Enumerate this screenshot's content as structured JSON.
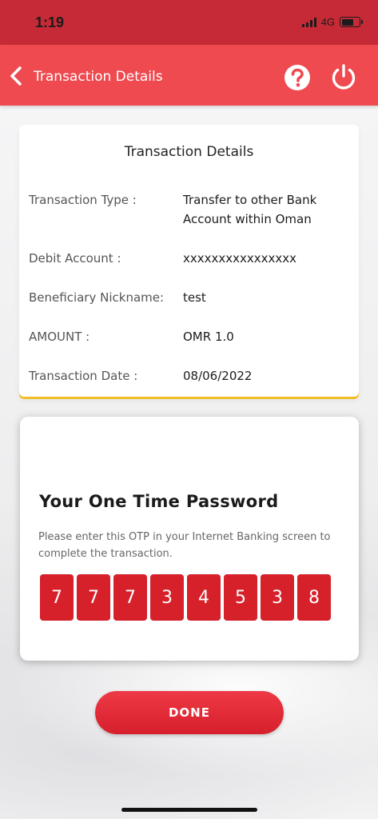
{
  "status_bar": {
    "time": "1:19",
    "network": "4G"
  },
  "header": {
    "title": "Transaction Details",
    "icons": [
      "chevron-left-icon",
      "help-icon",
      "power-icon"
    ]
  },
  "details": {
    "title": "Transaction Details",
    "rows": [
      {
        "label": "Transaction Type :",
        "value": "Transfer to other Bank Account within Oman"
      },
      {
        "label": "Debit Account :",
        "value": "xxxxxxxxxxxxxxxx"
      },
      {
        "label": "Beneficiary Nickname:",
        "value": "test"
      },
      {
        "label": "AMOUNT :",
        "value": "OMR 1.0"
      },
      {
        "label": "Transaction Date :",
        "value": "08/06/2022"
      }
    ]
  },
  "otp": {
    "heading": "Your One Time Password",
    "instruction": "Please enter this OTP in your Internet Banking screen to complete the transaction.",
    "digits": [
      "7",
      "7",
      "7",
      "3",
      "4",
      "5",
      "3",
      "8"
    ]
  },
  "done_label": "DONE",
  "colors": {
    "status_bar": "#c62a36",
    "header": "#ee4a50",
    "accent_red": "#d6202a",
    "card_underline": "#f0bd2a"
  }
}
